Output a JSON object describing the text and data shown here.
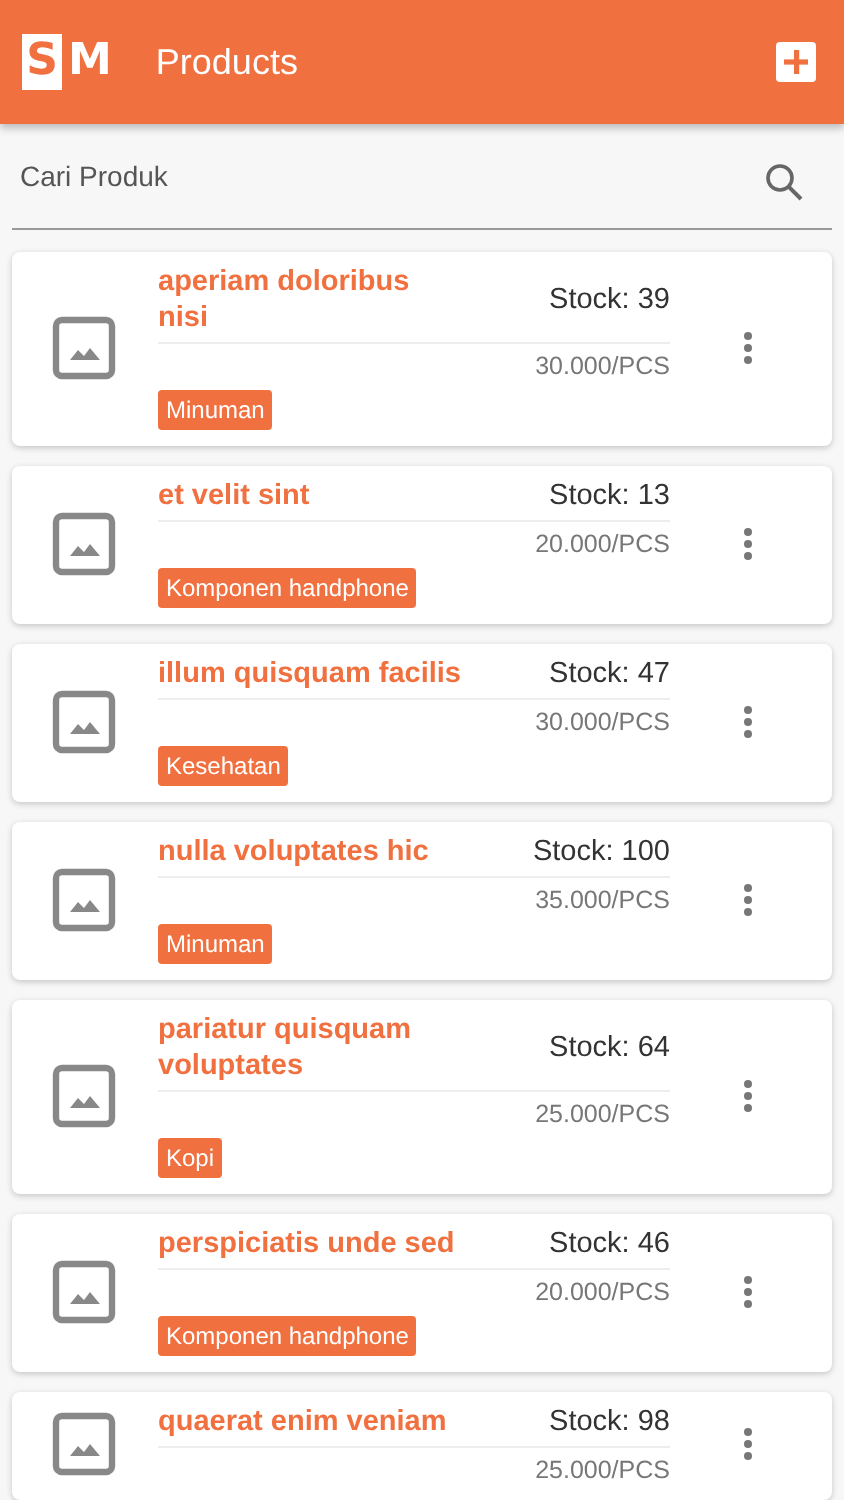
{
  "app_bar": {
    "logo": [
      "S",
      "M"
    ],
    "title": "Products"
  },
  "search": {
    "placeholder": "Cari Produk"
  },
  "products": [
    {
      "name": "aperiam doloribus nisi",
      "stock": "Stock: 39",
      "price": "30.000/PCS",
      "category": "Minuman"
    },
    {
      "name": "et velit sint",
      "stock": "Stock: 13",
      "price": "20.000/PCS",
      "category": "Komponen handphone"
    },
    {
      "name": "illum quisquam facilis",
      "stock": "Stock: 47",
      "price": "30.000/PCS",
      "category": "Kesehatan"
    },
    {
      "name": "nulla voluptates hic",
      "stock": "Stock: 100",
      "price": "35.000/PCS",
      "category": "Minuman"
    },
    {
      "name": "pariatur quisquam voluptates",
      "stock": "Stock: 64",
      "price": "25.000/PCS",
      "category": "Kopi"
    },
    {
      "name": "perspiciatis unde sed",
      "stock": "Stock: 46",
      "price": "20.000/PCS",
      "category": "Komponen handphone"
    },
    {
      "name": "quaerat enim veniam",
      "stock": "Stock: 98",
      "price": "25.000/PCS"
    }
  ]
}
